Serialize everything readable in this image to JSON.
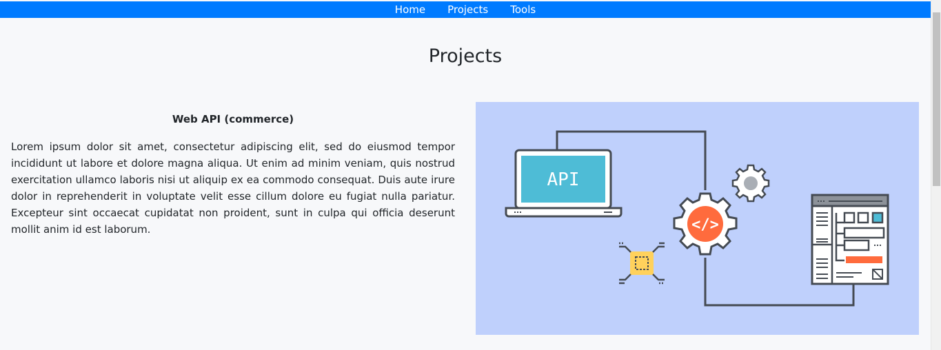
{
  "nav": {
    "items": [
      {
        "label": "Home"
      },
      {
        "label": "Projects"
      },
      {
        "label": "Tools"
      }
    ],
    "background": "#007bff"
  },
  "page": {
    "title": "Projects"
  },
  "project": {
    "title": "Web API (commerce)",
    "description": "Lorem ipsum dolor sit amet, consectetur adipiscing elit, sed do eiusmod tempor incididunt ut labore et dolore magna aliqua. Ut enim ad minim veniam, quis nostrud exercitation ullamco laboris nisi ut aliquip ex ea commodo consequat. Duis aute irure dolor in reprehenderit in voluptate velit esse cillum dolore eu fugiat nulla pariatur. Excepteur sint occaecat cupidatat non proident, sunt in culpa qui officia deserunt mollit anim id est laborum.",
    "illustration": {
      "laptop_label": "API",
      "background": "#bfd0fc",
      "accent_screen": "#4ebcd6",
      "accent_gear": "#ff6b3d",
      "accent_chip": "#ffd15c"
    }
  }
}
